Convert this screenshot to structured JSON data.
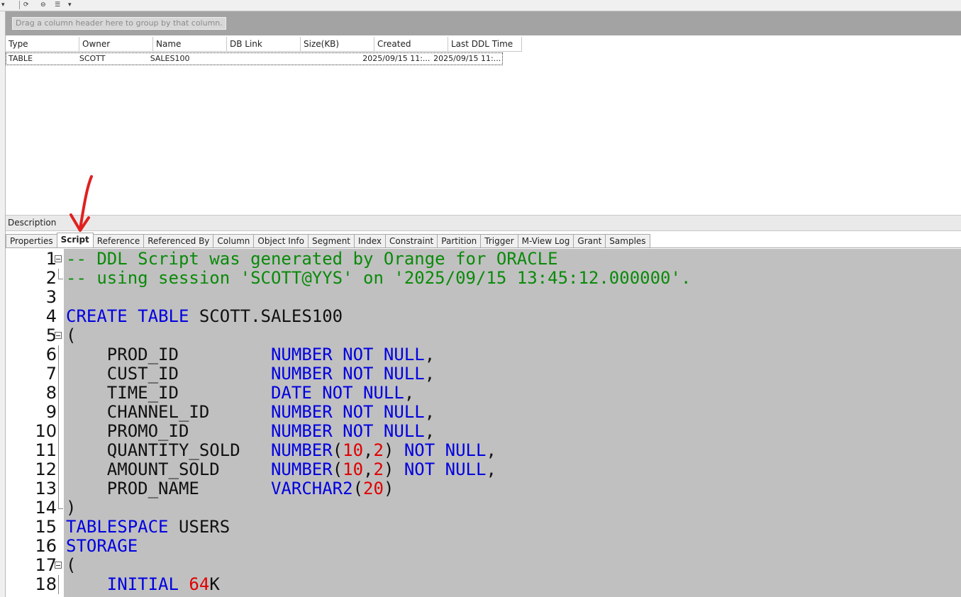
{
  "group_panel": {
    "hint": "Drag a column header here to group by that column."
  },
  "grid": {
    "columns": [
      "Type",
      "Owner",
      "Name",
      "DB Link",
      "Size(KB)",
      "Created",
      "Last DDL Time"
    ],
    "rows": [
      [
        "TABLE",
        "SCOTT",
        "SALES100",
        "",
        "",
        "2025/09/15 11:...",
        "2025/09/15 11:..."
      ]
    ]
  },
  "description": {
    "label": "Description"
  },
  "tabs": [
    "Properties",
    "Script",
    "Reference",
    "Referenced By",
    "Column",
    "Object Info",
    "Segment",
    "Index",
    "Constraint",
    "Partition",
    "Trigger",
    "M-View Log",
    "Grant",
    "Samples"
  ],
  "active_tab": "Script",
  "colors": {
    "comment": "#0a8a0a",
    "keyword": "#0000e0",
    "number": "#e00000",
    "editor_bg": "#c0c0c0",
    "annotation_arrow": "#e02020"
  },
  "editor": {
    "lines": [
      {
        "num": "1",
        "fold": "open",
        "tokens": [
          {
            "t": "c",
            "v": "-- DDL Script was generated by Orange for ORACLE"
          }
        ]
      },
      {
        "num": "2",
        "fold": "end",
        "tokens": [
          {
            "t": "c",
            "v": "-- using session 'SCOTT@YYS' on '2025/09/15 13:45:12.000000'."
          }
        ]
      },
      {
        "num": "3",
        "fold": "",
        "tokens": []
      },
      {
        "num": "4",
        "fold": "",
        "tokens": [
          {
            "t": "k",
            "v": "CREATE TABLE"
          },
          {
            "t": "d",
            "v": " SCOTT.SALES100"
          }
        ]
      },
      {
        "num": "5",
        "fold": "open",
        "tokens": [
          {
            "t": "d",
            "v": "("
          }
        ]
      },
      {
        "num": "6",
        "fold": "line",
        "tokens": [
          {
            "t": "d",
            "v": "    PROD_ID         "
          },
          {
            "t": "k",
            "v": "NUMBER NOT NULL"
          },
          {
            "t": "d",
            "v": ","
          }
        ]
      },
      {
        "num": "7",
        "fold": "line",
        "tokens": [
          {
            "t": "d",
            "v": "    CUST_ID         "
          },
          {
            "t": "k",
            "v": "NUMBER NOT NULL"
          },
          {
            "t": "d",
            "v": ","
          }
        ]
      },
      {
        "num": "8",
        "fold": "line",
        "tokens": [
          {
            "t": "d",
            "v": "    TIME_ID         "
          },
          {
            "t": "k",
            "v": "DATE NOT NULL"
          },
          {
            "t": "d",
            "v": ","
          }
        ]
      },
      {
        "num": "9",
        "fold": "line",
        "tokens": [
          {
            "t": "d",
            "v": "    CHANNEL_ID      "
          },
          {
            "t": "k",
            "v": "NUMBER NOT NULL"
          },
          {
            "t": "d",
            "v": ","
          }
        ]
      },
      {
        "num": "10",
        "fold": "line",
        "tokens": [
          {
            "t": "d",
            "v": "    PROMO_ID        "
          },
          {
            "t": "k",
            "v": "NUMBER NOT NULL"
          },
          {
            "t": "d",
            "v": ","
          }
        ]
      },
      {
        "num": "11",
        "fold": "line",
        "tokens": [
          {
            "t": "d",
            "v": "    QUANTITY_SOLD   "
          },
          {
            "t": "k",
            "v": "NUMBER"
          },
          {
            "t": "d",
            "v": "("
          },
          {
            "t": "n",
            "v": "10"
          },
          {
            "t": "d",
            "v": ","
          },
          {
            "t": "n",
            "v": "2"
          },
          {
            "t": "d",
            "v": ") "
          },
          {
            "t": "k",
            "v": "NOT NULL"
          },
          {
            "t": "d",
            "v": ","
          }
        ]
      },
      {
        "num": "12",
        "fold": "line",
        "tokens": [
          {
            "t": "d",
            "v": "    AMOUNT_SOLD     "
          },
          {
            "t": "k",
            "v": "NUMBER"
          },
          {
            "t": "d",
            "v": "("
          },
          {
            "t": "n",
            "v": "10"
          },
          {
            "t": "d",
            "v": ","
          },
          {
            "t": "n",
            "v": "2"
          },
          {
            "t": "d",
            "v": ") "
          },
          {
            "t": "k",
            "v": "NOT NULL"
          },
          {
            "t": "d",
            "v": ","
          }
        ]
      },
      {
        "num": "13",
        "fold": "line",
        "tokens": [
          {
            "t": "d",
            "v": "    PROD_NAME       "
          },
          {
            "t": "k",
            "v": "VARCHAR2"
          },
          {
            "t": "d",
            "v": "("
          },
          {
            "t": "n",
            "v": "20"
          },
          {
            "t": "d",
            "v": ")"
          }
        ]
      },
      {
        "num": "14",
        "fold": "end",
        "tokens": [
          {
            "t": "d",
            "v": ")"
          }
        ]
      },
      {
        "num": "15",
        "fold": "",
        "tokens": [
          {
            "t": "k",
            "v": "TABLESPACE"
          },
          {
            "t": "d",
            "v": " USERS"
          }
        ]
      },
      {
        "num": "16",
        "fold": "",
        "tokens": [
          {
            "t": "k",
            "v": "STORAGE"
          }
        ]
      },
      {
        "num": "17",
        "fold": "open",
        "tokens": [
          {
            "t": "d",
            "v": "("
          }
        ]
      },
      {
        "num": "18",
        "fold": "line",
        "tokens": [
          {
            "t": "d",
            "v": "    "
          },
          {
            "t": "k",
            "v": "INITIAL"
          },
          {
            "t": "d",
            "v": " "
          },
          {
            "t": "n",
            "v": "64"
          },
          {
            "t": "d",
            "v": "K"
          }
        ]
      }
    ]
  }
}
